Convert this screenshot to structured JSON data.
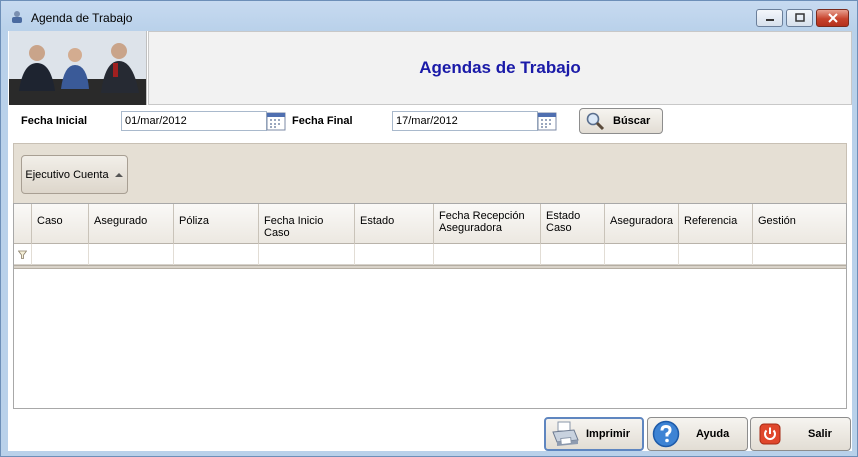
{
  "window": {
    "title": "Agenda de Trabajo"
  },
  "header": {
    "title": "Agendas de Trabajo"
  },
  "filters": {
    "start_label": "Fecha Inicial",
    "start_value": "01/mar/2012",
    "end_label": "Fecha Final",
    "end_value": "17/mar/2012",
    "search_label": "Búscar"
  },
  "grid": {
    "group_by_chip": "Ejecutivo Cuenta",
    "columns": [
      "Caso",
      "Asegurado",
      "Póliza",
      "Fecha Inicio Caso",
      "Estado",
      "Fecha Recepción Aseguradora",
      "Estado Caso",
      "Aseguradora",
      "Referencia",
      "Gestión"
    ]
  },
  "footer": {
    "print_label": "Imprimir",
    "help_label": "Ayuda",
    "exit_label": "Salir"
  },
  "icons": {
    "window": "app-icon",
    "calendar": "calendar-icon",
    "search": "magnifier-icon",
    "print": "printer-icon",
    "help": "question-icon",
    "exit": "power-icon",
    "filter": "funnel-icon"
  },
  "colors": {
    "title": "#1a1aa8",
    "accent": "#e5dfd4"
  }
}
